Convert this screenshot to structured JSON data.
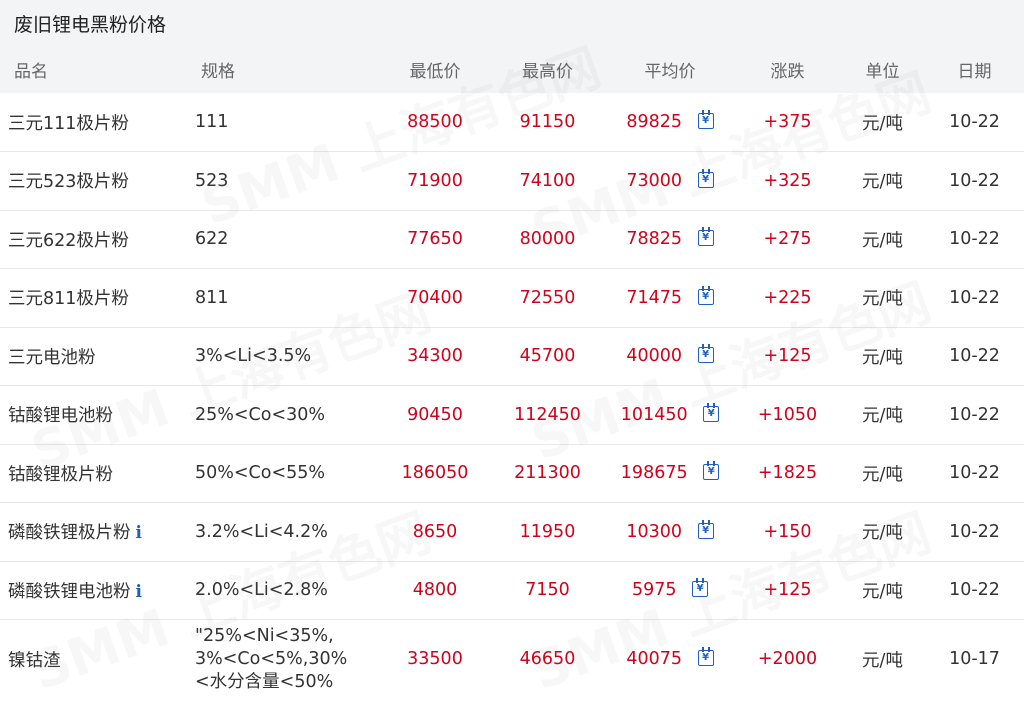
{
  "page_title": "废旧锂电黑粉价格",
  "headers": [
    "品名",
    "规格",
    "最低价",
    "最高价",
    "平均价",
    "涨跌",
    "单位",
    "日期"
  ],
  "watermark_text": "SMM 上海有色网",
  "rows": [
    {
      "name": "三元111极片粉",
      "spec": "111",
      "low": "88500",
      "high": "91150",
      "avg": "89825",
      "change": "+375",
      "unit": "元/吨",
      "date": "10-22",
      "info": false
    },
    {
      "name": "三元523极片粉",
      "spec": "523",
      "low": "71900",
      "high": "74100",
      "avg": "73000",
      "change": "+325",
      "unit": "元/吨",
      "date": "10-22",
      "info": false
    },
    {
      "name": "三元622极片粉",
      "spec": "622",
      "low": "77650",
      "high": "80000",
      "avg": "78825",
      "change": "+275",
      "unit": "元/吨",
      "date": "10-22",
      "info": false
    },
    {
      "name": "三元811极片粉",
      "spec": "811",
      "low": "70400",
      "high": "72550",
      "avg": "71475",
      "change": "+225",
      "unit": "元/吨",
      "date": "10-22",
      "info": false
    },
    {
      "name": "三元电池粉",
      "spec": "3%<Li<3.5%",
      "low": "34300",
      "high": "45700",
      "avg": "40000",
      "change": "+125",
      "unit": "元/吨",
      "date": "10-22",
      "info": false
    },
    {
      "name": "钴酸锂电池粉",
      "spec": "25%<Co<30%",
      "low": "90450",
      "high": "112450",
      "avg": "101450",
      "change": "+1050",
      "unit": "元/吨",
      "date": "10-22",
      "info": false
    },
    {
      "name": "钴酸锂极片粉",
      "spec": "50%<Co<55%",
      "low": "186050",
      "high": "211300",
      "avg": "198675",
      "change": "+1825",
      "unit": "元/吨",
      "date": "10-22",
      "info": false
    },
    {
      "name": "磷酸铁锂极片粉",
      "spec": "3.2%<Li<4.2%",
      "low": "8650",
      "high": "11950",
      "avg": "10300",
      "change": "+150",
      "unit": "元/吨",
      "date": "10-22",
      "info": true
    },
    {
      "name": "磷酸铁锂电池粉",
      "spec": "2.0%<Li<2.8%",
      "low": "4800",
      "high": "7150",
      "avg": "5975",
      "change": "+125",
      "unit": "元/吨",
      "date": "10-22",
      "info": true
    },
    {
      "name": "镍钴渣",
      "spec": "\"25%<Ni<35%,\n3%<Co<5%,30%\n<水分含量<50%",
      "low": "33500",
      "high": "46650",
      "avg": "40075",
      "change": "+2000",
      "unit": "元/吨",
      "date": "10-17",
      "info": false
    }
  ],
  "icons": {
    "info": "i",
    "calendar": "¥"
  },
  "colors": {
    "price_red": "#d0021b",
    "icon_blue": "#1f5fbf",
    "header_bg": "#f3f4f6"
  }
}
